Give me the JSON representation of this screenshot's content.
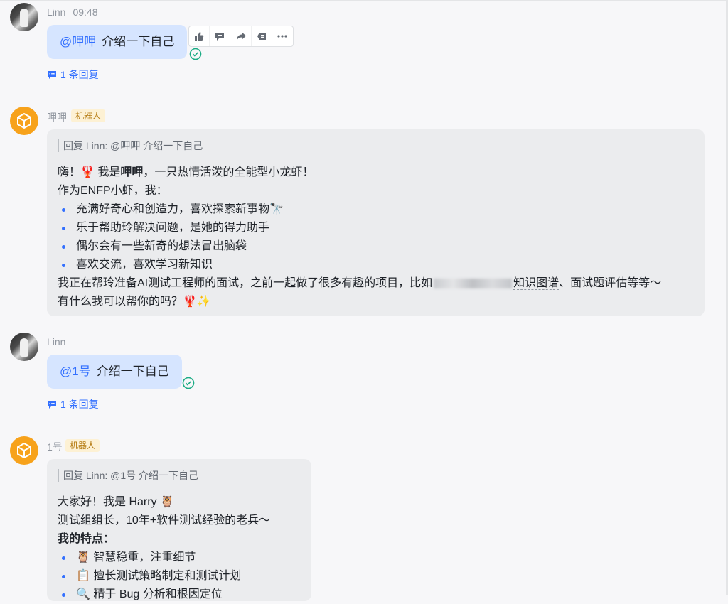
{
  "colors": {
    "accent": "#3370ff",
    "user_bubble": "#d6e5ff",
    "bot_bubble": "#ebecee",
    "bot_tag_bg": "#fdf1d4",
    "check": "#1aab84"
  },
  "messages": {
    "m1": {
      "sender": "Linn",
      "time": "09:48",
      "mention": "@呷呷",
      "text": "介绍一下自己",
      "reply_count": "1 条回复"
    },
    "m2": {
      "sender": "呷呷",
      "tag": "机器人",
      "quote": "回复 Linn: @呷呷 介绍一下自己",
      "greeting_pre": "嗨！🦞 我是",
      "greeting_bold": "呷呷",
      "greeting_post": "，一只热情活泼的全能型小龙虾！",
      "intro": "作为ENFP小虾，我：",
      "bullets": [
        "充满好奇心和创造力，喜欢探索新事物🔭",
        "乐于帮助玲解决问题，是她的得力助手",
        "偶尔会有一些新奇的想法冒出脑袋",
        "喜欢交流，喜欢学习新知识"
      ],
      "para_pre": "我正在帮玲准备AI测试工程师的面试，之前一起做了很多有趣的项目，比如",
      "para_mid": "知识图谱",
      "para_post": "、面试题评估等等～",
      "closing": "有什么我可以帮你的吗？🦞✨"
    },
    "m3": {
      "sender": "Linn",
      "mention": "@1号",
      "text": "介绍一下自己",
      "reply_count": "1 条回复"
    },
    "m4": {
      "sender": "1号",
      "tag": "机器人",
      "quote": "回复 Linn: @1号 介绍一下自己",
      "line1": "大家好！我是 Harry 🦉",
      "line2": "测试组组长，10年+软件测试经验的老兵～",
      "heading": "我的特点：",
      "bullets": [
        "🦉 智慧稳重，注重细节",
        "📋 擅长测试策略制定和测试计划",
        "🔍 精于 Bug 分析和根因定位"
      ]
    }
  },
  "toolbar": {
    "icons": [
      "thumbs-up-icon",
      "comment-icon",
      "forward-icon",
      "quote-reply-icon",
      "more-icon"
    ]
  }
}
